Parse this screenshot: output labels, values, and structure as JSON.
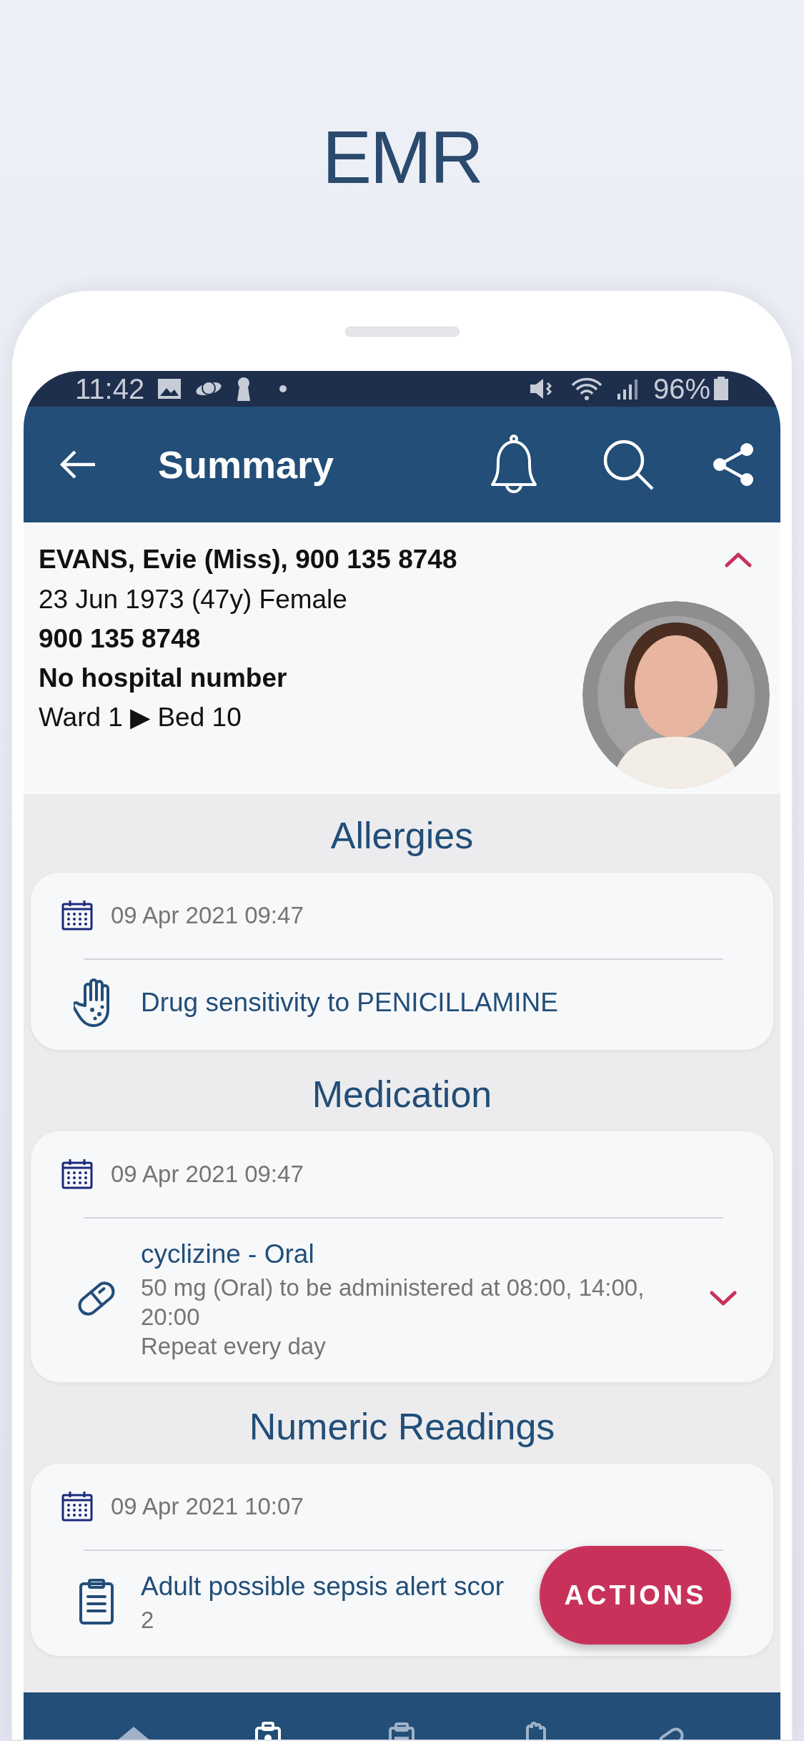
{
  "title": "EMR",
  "status_bar": {
    "time": "11:42",
    "battery": "96%"
  },
  "app_bar": {
    "title": "Summary"
  },
  "patient": {
    "name_line": "EVANS, Evie (Miss), 900 135 8748",
    "expanded": true,
    "lines": [
      {
        "text": "23 Jun 1973 (47y) Female",
        "bold": false
      },
      {
        "text": "900 135 8748",
        "bold": true
      },
      {
        "text": "No hospital number",
        "bold": true
      },
      {
        "text": "Ward 1 ▶ Bed 10",
        "bold": false
      }
    ]
  },
  "sections": [
    {
      "title": "Allergies",
      "date": "09 Apr 2021 09:47",
      "entries": [
        {
          "kind": "allergy",
          "title": "Drug sensitivity to PENICILLAMINE"
        }
      ]
    },
    {
      "title": "Medication",
      "date": "09 Apr 2021 09:47",
      "entries": [
        {
          "kind": "medication",
          "title": "cyclizine - Oral",
          "details": [
            "50 mg (Oral) to be administered at 08:00, 14:00, 20:00",
            "Repeat every day"
          ],
          "expanded": false
        }
      ]
    },
    {
      "title": "Numeric Readings",
      "date": "09 Apr 2021 10:07",
      "entries": [
        {
          "kind": "reading",
          "title": "Adult possible sepsis alert scor",
          "details": [
            "2"
          ]
        }
      ]
    }
  ],
  "fab": {
    "label": "ACTIONS"
  },
  "bottom_nav": [
    {
      "selected": false
    },
    {
      "selected": true
    },
    {
      "selected": false
    },
    {
      "selected": false
    },
    {
      "selected": false
    }
  ]
}
